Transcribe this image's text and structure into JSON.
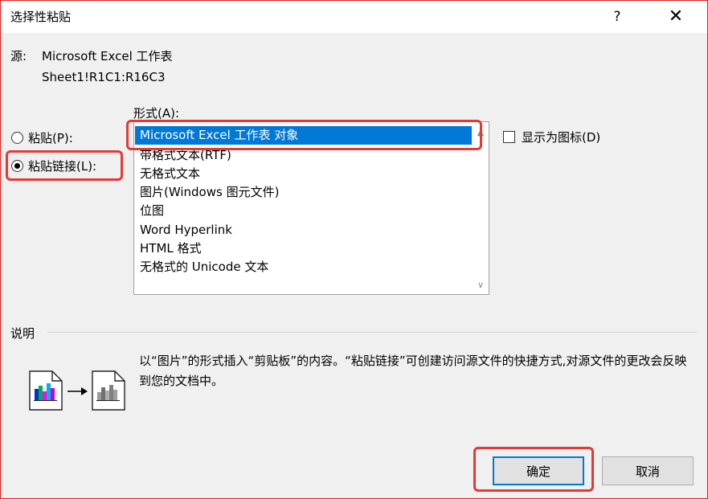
{
  "dialog": {
    "title": "选择性粘贴",
    "help_label": "?",
    "close_label": "✕"
  },
  "source": {
    "label": "源:",
    "value": "Microsoft Excel 工作表",
    "range": "Sheet1!R1C1:R16C3"
  },
  "as_label": "形式(A):",
  "radios": [
    {
      "label": "粘贴(P):",
      "checked": false
    },
    {
      "label": "粘贴链接(L):",
      "checked": true
    }
  ],
  "list": {
    "items": [
      "Microsoft Excel 工作表 对象",
      "带格式文本(RTF)",
      "无格式文本",
      "图片(Windows 图元文件)",
      "位图",
      "Word Hyperlink",
      "HTML 格式",
      "无格式的 Unicode 文本"
    ],
    "selected_index": 0
  },
  "display_as_icon": {
    "label": "显示为图标(D)",
    "checked": false
  },
  "description": {
    "label": "说明",
    "text": "以“图片”的形式插入“剪贴板”的内容。“粘贴链接”可创建访问源文件的快捷方式,对源文件的更改会反映到您的文档中。"
  },
  "buttons": {
    "ok": "确定",
    "cancel": "取消"
  },
  "colors": {
    "accent": "#0078d7",
    "highlight": "#e53935",
    "panel": "#f0f0f0"
  }
}
